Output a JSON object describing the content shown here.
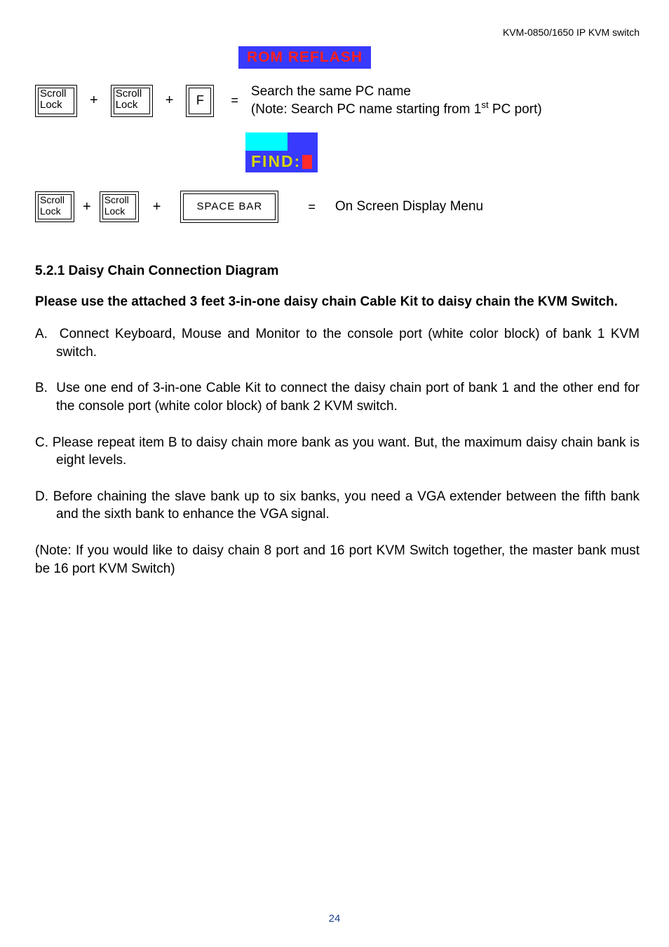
{
  "header": {
    "product": "KVM-0850/1650 IP KVM switch"
  },
  "osd": {
    "rom_reflash": "ROM   REFLASH",
    "find_label": "FIND:"
  },
  "keys": {
    "scroll_lock": "Scroll Lock",
    "f": "F",
    "space_bar": "SPACE   BAR",
    "plus": "+",
    "equals": "="
  },
  "row1": {
    "desc_main": "Search the same PC name",
    "desc_note_prefix": "(Note: Search PC name starting from 1",
    "desc_note_sup": "st",
    "desc_note_suffix": " PC port)"
  },
  "row2": {
    "desc": "On Screen Display Menu"
  },
  "section": {
    "heading": "5.2.1  Daisy Chain Connection Diagram",
    "instruction": "Please use the attached 3 feet 3-in-one daisy chain Cable Kit to daisy chain the KVM Switch.",
    "items": {
      "A": "Connect Keyboard, Mouse and Monitor to the console port (white color block) of bank 1 KVM switch.",
      "B": "Use one end of 3-in-one Cable Kit to connect the daisy chain port of bank 1 and the other end for the console port (white color block) of bank 2 KVM switch.",
      "C": "Please repeat item B to daisy chain more bank as you want. But, the maximum daisy chain bank is eight levels.",
      "D": "Before chaining the slave bank up to six banks, you need a VGA extender between the fifth bank and the sixth bank to enhance the VGA signal."
    },
    "note": "(Note: If you would like to daisy chain 8 port and 16 port KVM Switch together, the master bank must be 16 port KVM Switch)"
  },
  "page_number": "24"
}
